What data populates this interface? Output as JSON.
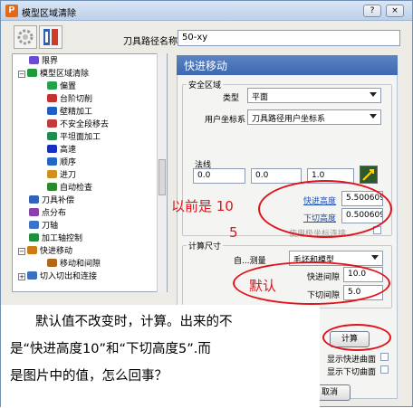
{
  "window": {
    "title": "模型区域清除",
    "help_button": "?",
    "close_button": "×"
  },
  "toolpath_name_label": "刀具路径名称",
  "toolpath_name_value": "50-xy",
  "tree": {
    "items": [
      {
        "label": "限界",
        "color": "#6a4bd1",
        "indent": 0
      },
      {
        "label": "模型区域清除",
        "color": "#1b9b3a",
        "indent": 0,
        "expander": "−"
      },
      {
        "label": "偏置",
        "color": "#23a24b",
        "indent": 2
      },
      {
        "label": "台阶切削",
        "color": "#c6302e",
        "indent": 2
      },
      {
        "label": "壁精加工",
        "color": "#1e5fbf",
        "indent": 2
      },
      {
        "label": "不安全段移去",
        "color": "#c23a3a",
        "indent": 2
      },
      {
        "label": "平坦面加工",
        "color": "#1f8c4f",
        "indent": 2
      },
      {
        "label": "高速",
        "color": "#1a2fbf",
        "indent": 2
      },
      {
        "label": "顺序",
        "color": "#2267c4",
        "indent": 2
      },
      {
        "label": "进刀",
        "color": "#d09020",
        "indent": 2
      },
      {
        "label": "自动检查",
        "color": "#2b8a2b",
        "indent": 2
      },
      {
        "label": "刀具补偿",
        "color": "#3363b8",
        "indent": 0
      },
      {
        "label": "点分布",
        "color": "#8a40a8",
        "indent": 0
      },
      {
        "label": "刀轴",
        "color": "#3a74c8",
        "indent": 0
      },
      {
        "label": "加工轴控制",
        "color": "#1e8f3a",
        "indent": 0
      },
      {
        "label": "快进移动",
        "color": "#cc7a11",
        "indent": 0,
        "expander": "−"
      },
      {
        "label": "移动和间隙",
        "color": "#b2661a",
        "indent": 2
      },
      {
        "label": "切入切出和连接",
        "color": "#3c6fc2",
        "indent": 0,
        "expander": "+"
      }
    ]
  },
  "panel": {
    "header": "快进移动",
    "safe_area_group": "安全区域",
    "type_label": "类型",
    "type_value": "平面",
    "ucs_label": "用户坐标系",
    "ucs_value": "刀具路径用户坐标系",
    "normal_label": "法线",
    "normal_x": "0.0",
    "normal_y": "0.0",
    "normal_z": "1.0",
    "rapid_height_label": "快进高度",
    "rapid_height_value": "5.500609",
    "plunge_height_label": "下切高度",
    "plunge_height_value": "0.500609",
    "use_ucs_label": "使用极坐标连接",
    "calc_group": "计算尺寸",
    "auto_label": "自...测量",
    "auto_value": "毛坯和模型",
    "rapid_gap_label": "快进间隙",
    "rapid_gap_value": "10.0",
    "plunge_gap_label": "下切间隙",
    "plunge_gap_value": "5.0",
    "calc_button": "计算",
    "show_rapid_label": "显示快进曲面",
    "show_plunge_label": "显示下切曲面",
    "cancel_button": "取消"
  },
  "annotations": {
    "previous_label": "以前是 10",
    "previous_label_2": "5",
    "default_label": "默认"
  },
  "note": {
    "line1": "默认值不改变时，计算。出来的不",
    "line2": "是“快进高度10”和“下切高度5”.而",
    "line3": "是图片中的值，怎么回事？"
  },
  "colors": {
    "accent": "#3e68b0",
    "annotation": "#e1121b",
    "link": "#1b4fb5"
  }
}
